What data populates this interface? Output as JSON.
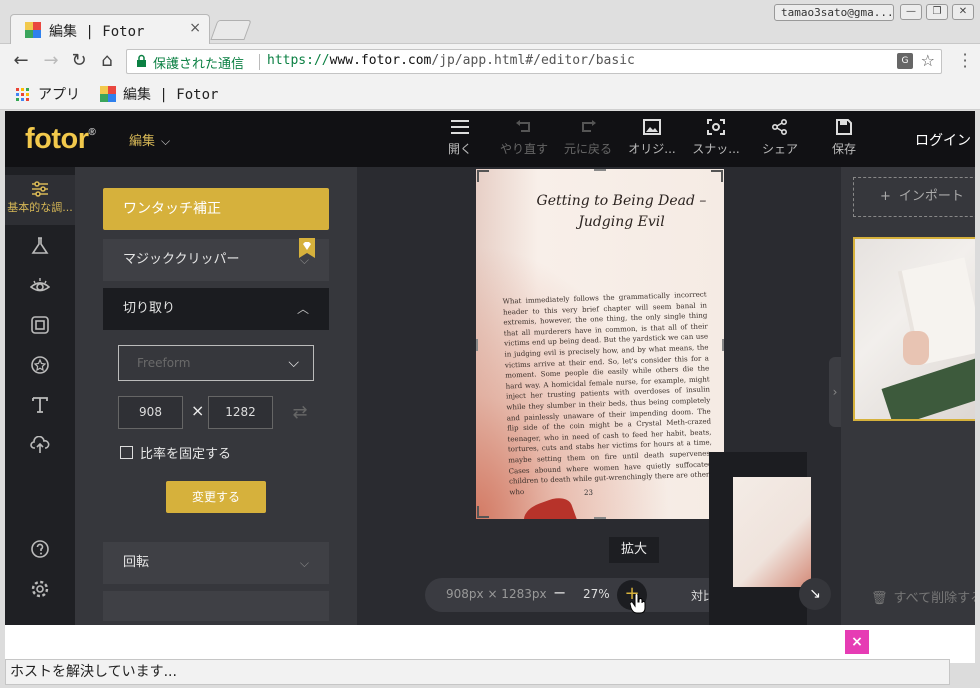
{
  "browser": {
    "tab_title": "編集 | Fotor",
    "tab_close": "×",
    "profile": "tamao3sato@gma...",
    "window_buttons": [
      "—",
      "❐",
      "✕"
    ],
    "secure_label": "保護された通信",
    "url_scheme": "https://",
    "url_host": "www.fotor.com",
    "url_path": "/jp/app.html#/editor/basic",
    "bookmarks": [
      "アプリ",
      "編集 | Fotor"
    ],
    "status_text": "ホストを解決しています..."
  },
  "app": {
    "logo": "fotor",
    "logo_mark": "®",
    "menu_label": "編集",
    "toolbar": [
      {
        "label": "開く",
        "icon": "menu-icon",
        "enabled": true
      },
      {
        "label": "やり直す",
        "icon": "undo-icon",
        "enabled": false
      },
      {
        "label": "元に戻る",
        "icon": "redo-icon",
        "enabled": false
      },
      {
        "label": "オリジ...",
        "icon": "image-icon",
        "enabled": true
      },
      {
        "label": "スナッ...",
        "icon": "snapshot-icon",
        "enabled": true
      },
      {
        "label": "シェア",
        "icon": "share-icon",
        "enabled": true
      },
      {
        "label": "保存",
        "icon": "save-icon",
        "enabled": true
      }
    ],
    "login": "ログイン",
    "sidebar_active_label": "基本的な調...",
    "panel": {
      "one_touch": "ワンタッチ補正",
      "magic_clipper": "マジッククリッパー",
      "crop": "切り取り",
      "crop_mode": "Freeform",
      "width": "908",
      "height": "1282",
      "times": "×",
      "lock_ratio": "比率を固定する",
      "apply": "変更する",
      "rotate": "回転"
    },
    "canvas": {
      "book_title_line1": "Getting to Being Dead –",
      "book_title_line2": "Judging Evil",
      "book_text": "What immediately follows the grammatically incorrect header to this very brief chapter will seem banal in extremis, however, the one thing, the only single thing that all murderers have in common, is that all of their victims end up being dead. But the yardstick we can use in judging evil is precisely how, and by what means, the victims arrive at their end. So, let's consider this for a moment. Some people die easily while others die the hard way. A homicidal female nurse, for example, might inject her trusting patients with overdoses of insulin while they slumber in their beds, thus being completely and painlessly unaware of their impending doom. The flip side of the coin might be a Crystal Meth-crazed teenager, who in need of cash to feed her habit, beats, tortures, cuts and stabs her victims for hours at a time, maybe setting them on fire until death supervenes. Cases abound where women have quietly suffocated children to death while gut-wrenchingly there are others who",
      "page_number": "23",
      "zoom_tooltip": "拡大",
      "image_size": "908px × 1283px",
      "zoom_minus": "−",
      "zoom_percent": "27%",
      "zoom_plus": "+",
      "compare": "対比"
    },
    "right_panel": {
      "import": "インポート",
      "delete_all": "すべて削除する"
    },
    "accent_color": "#d6b13c",
    "ad_close": "×"
  }
}
